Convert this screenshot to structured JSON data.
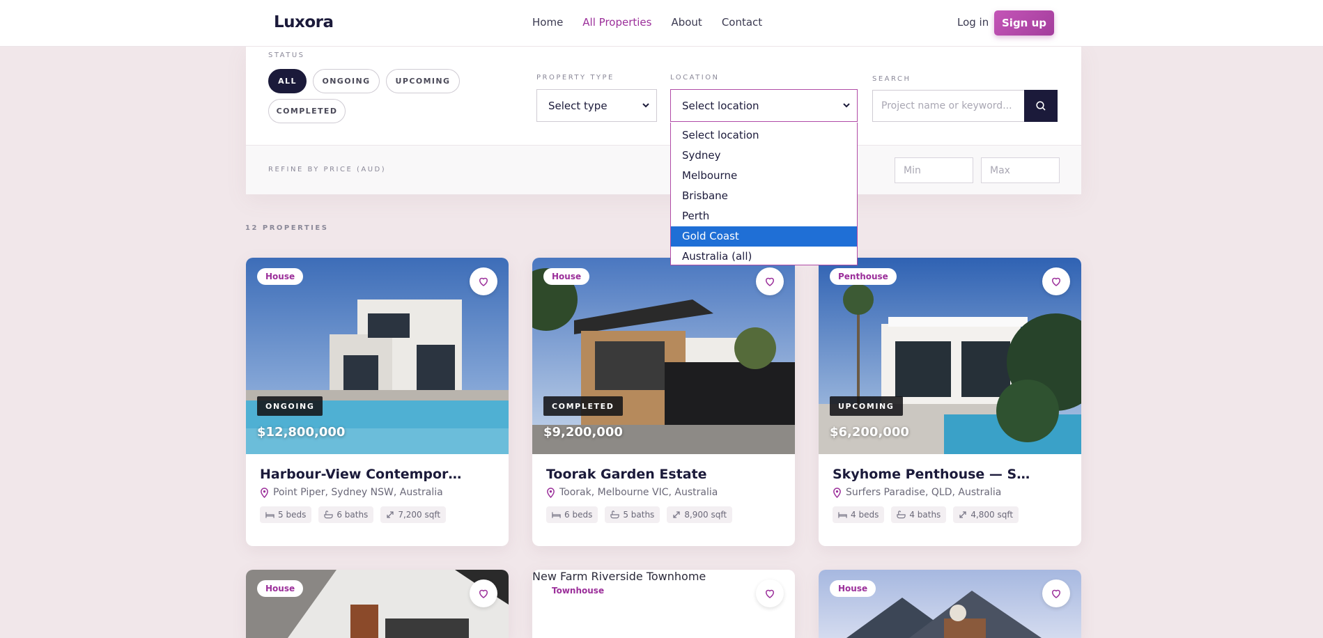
{
  "brand": "Luxora",
  "nav": [
    {
      "label": "Home"
    },
    {
      "label": "All Properties"
    },
    {
      "label": "About"
    },
    {
      "label": "Contact"
    }
  ],
  "auth": {
    "login": "Log in",
    "signup": "Sign up"
  },
  "filters": {
    "status_label": "STATUS",
    "status_options": [
      "ALL",
      "ONGOING",
      "UPCOMING",
      "COMPLETED"
    ],
    "status_selected": "ALL",
    "property_type_label": "PROPERTY TYPE",
    "property_type_value": "Select type",
    "location_label": "LOCATION",
    "location_value": "Select location",
    "location_options": [
      "Select location",
      "Sydney",
      "Melbourne",
      "Brisbane",
      "Perth",
      "Gold Coast",
      "Australia (all)"
    ],
    "location_highlighted": "Gold Coast",
    "search_label": "SEARCH",
    "search_placeholder": "Project name or keyword...",
    "price_label": "REFINE BY PRICE (AUD)",
    "price_min_placeholder": "Min",
    "price_max_placeholder": "Max"
  },
  "results": {
    "count_label": "12 PROPERTIES",
    "cards": [
      {
        "type": "House",
        "status": "ONGOING",
        "price": "$12,800,000",
        "title": "Harbour-View Contemporary...",
        "address": "Point Piper, Sydney NSW, Australia",
        "beds": "5 beds",
        "baths": "6 baths",
        "area": "7,200 sqft"
      },
      {
        "type": "House",
        "status": "COMPLETED",
        "price": "$9,200,000",
        "title": "Toorak Garden Estate",
        "address": "Toorak, Melbourne VIC, Australia",
        "beds": "6 beds",
        "baths": "5 baths",
        "area": "8,900 sqft"
      },
      {
        "type": "Penthouse",
        "status": "UPCOMING",
        "price": "$6,200,000",
        "title": "Skyhome Penthouse — Surfers...",
        "address": "Surfers Paradise, QLD, Australia",
        "beds": "4 beds",
        "baths": "4 baths",
        "area": "4,800 sqft"
      },
      {
        "type": "House"
      },
      {
        "type": "Townhouse",
        "image_alt": "New Farm Riverside Townhome"
      },
      {
        "type": "House"
      }
    ]
  },
  "colors": {
    "accent": "#9b2f9a",
    "navy": "#1b1a3a",
    "page_bg": "#f1e7ea",
    "highlight": "#1f6fd6"
  }
}
